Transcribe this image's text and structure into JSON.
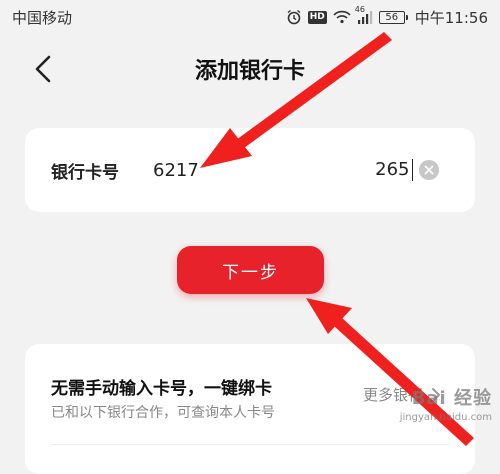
{
  "status_bar": {
    "carrier": "中国移动",
    "network_badge": "46",
    "hd_badge": "HD",
    "battery": "56",
    "time": "中午11:56",
    "icons": [
      "alarm-icon",
      "hd-icon",
      "wifi-icon",
      "signal-icon",
      "battery-icon"
    ]
  },
  "nav": {
    "title": "添加银行卡",
    "back_icon": "chevron-left-icon"
  },
  "card_input": {
    "label": "银行卡号",
    "value_start": "6217",
    "value_end": "265",
    "clear_icon": "clear-icon"
  },
  "next_button": {
    "label": "下一步",
    "color": "#e8222a"
  },
  "bind_section": {
    "title": "无需手动输入卡号，一键绑卡",
    "subtitle": "已和以下银行合作，可查询本人卡号",
    "more_link": "更多银行"
  },
  "watermark": {
    "logo": "Bai 经验",
    "url": "jingyan.baidu.com"
  },
  "annotation": {
    "arrow_color": "#f0201e"
  }
}
